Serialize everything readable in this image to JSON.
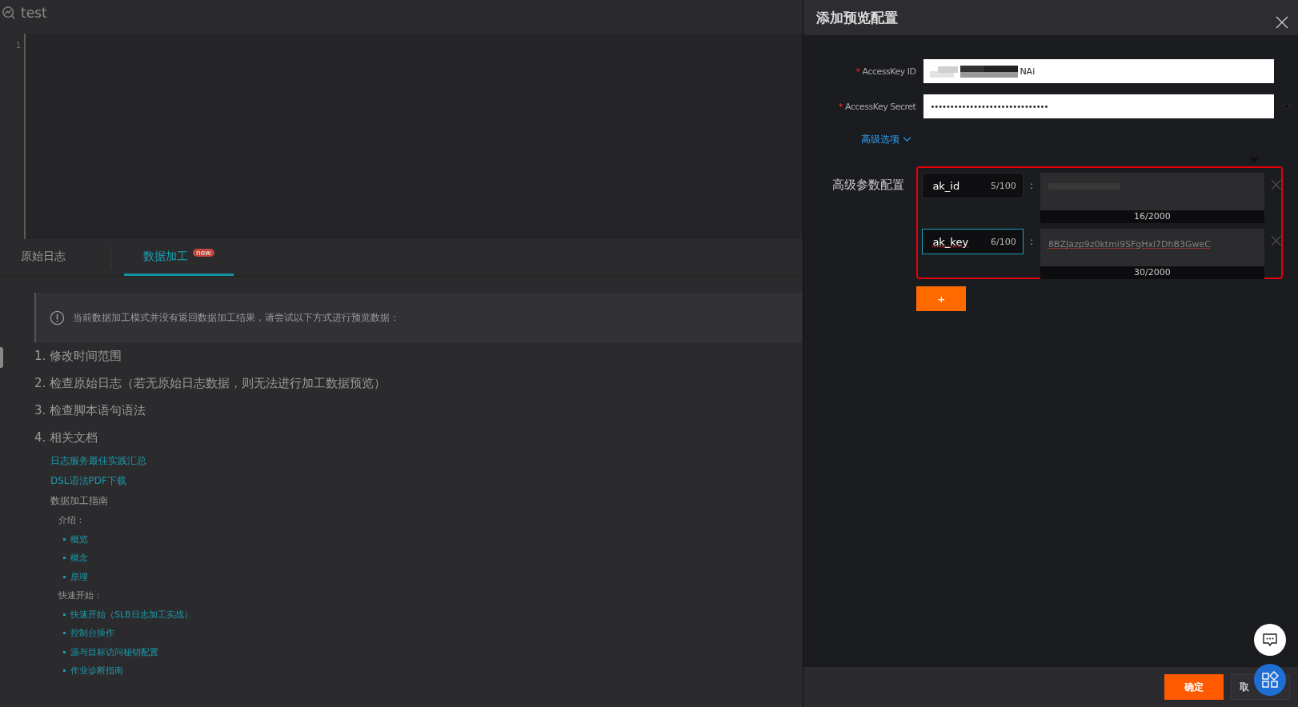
{
  "app": {
    "title": "test"
  },
  "editor": {
    "line_numbers": [
      "1"
    ]
  },
  "tabs": [
    {
      "label": "原始日志",
      "selected": false
    },
    {
      "label": "数据加工",
      "selected": true,
      "badge": "new"
    }
  ],
  "notice": {
    "text": "当前数据加工模式并没有返回数据加工结果，请尝试以下方式进行预览数据："
  },
  "steps": [
    "1. 修改时间范围",
    "2. 检查原始日志（若无原始日志数据，则无法进行加工数据预览）",
    "3. 检查脚本语句语法",
    "4. 相关文档"
  ],
  "docs": [
    {
      "kind": "link",
      "text": "日志服务最佳实践汇总"
    },
    {
      "kind": "link",
      "text": "DSL语法PDF下载"
    },
    {
      "kind": "heading",
      "text": "数据加工指南"
    },
    {
      "kind": "subheading",
      "text": "介绍："
    },
    {
      "kind": "bullet",
      "text": "概览"
    },
    {
      "kind": "bullet",
      "text": "概念"
    },
    {
      "kind": "bullet",
      "text": "原理"
    },
    {
      "kind": "subheading",
      "text": "快速开始："
    },
    {
      "kind": "bullet",
      "text": "快速开始（SLB日志加工实战）"
    },
    {
      "kind": "bullet",
      "text": "控制台操作"
    },
    {
      "kind": "bullet",
      "text": "源与目标访问秘钥配置"
    },
    {
      "kind": "bullet",
      "text": "作业诊断指南"
    }
  ],
  "drawer": {
    "title": "添加预览配置",
    "fields": [
      {
        "label": "AccessKey ID",
        "required_mark": "*",
        "kind": "text",
        "value": "NAi"
      },
      {
        "label": "AccessKey Secret",
        "required_mark": "*",
        "kind": "password",
        "value": "••••••••••••••••••••••••••••••"
      }
    ],
    "advanced_toggle": "高级选项",
    "advanced": {
      "label": "高级参数配置",
      "params": [
        {
          "key": "ak_id",
          "key_count": "5/100",
          "separator": ":",
          "focused": false,
          "key_misspelled": false,
          "value_count": "16/2000"
        },
        {
          "key": "ak_key",
          "key_count": "6/100",
          "separator": ":",
          "focused": true,
          "key_misspelled": true,
          "value": "8BZJazp9z0ktmi9SFgHxl7DhB3GweC",
          "value_misspelled": true,
          "value_count": "30/2000"
        }
      ],
      "add_button": "+"
    },
    "buttons": [
      {
        "label": "确定",
        "kind": "primary"
      },
      {
        "label": "取",
        "kind": "secondary"
      }
    ]
  }
}
